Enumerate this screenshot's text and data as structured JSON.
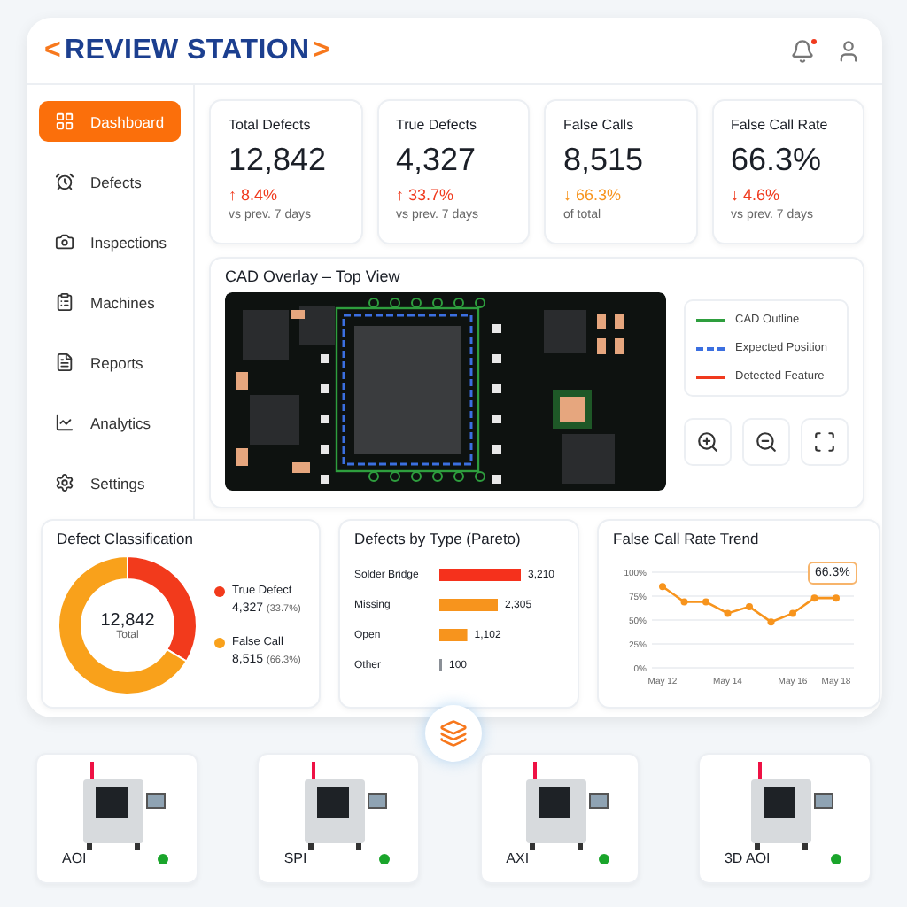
{
  "header": {
    "logo": {
      "left": "<",
      "text": "REVIEW STATION",
      "right": ">"
    },
    "notification": true
  },
  "sidebar": {
    "items": [
      {
        "label": "Dashboard",
        "selected": true
      },
      {
        "label": "Defects",
        "selected": false
      },
      {
        "label": "Inspections",
        "selected": false
      },
      {
        "label": "Machines",
        "selected": false
      },
      {
        "label": "Reports",
        "selected": false
      },
      {
        "label": "Analytics",
        "selected": false
      },
      {
        "label": "Settings",
        "selected": false
      }
    ]
  },
  "kpis": [
    {
      "title": "Total Defects",
      "value": "12,842",
      "delta": "↑ 8.4%",
      "color": "#f03a1e",
      "note": "vs prev. 7 days"
    },
    {
      "title": "True Defects",
      "value": "4,327",
      "delta": "↑ 33.7%",
      "color": "#f03a1e",
      "note": "vs prev. 7 days"
    },
    {
      "title": "False Calls",
      "value": "8,515",
      "delta": "↓ 66.3%",
      "color": "#f7941d",
      "note": "of total"
    },
    {
      "title": "False Call Rate",
      "value": "66.3%",
      "delta": "↓ 4.6%",
      "color": "#f03a1e",
      "note": "vs prev. 7 days"
    }
  ],
  "cad": {
    "title": "CAD Overlay – Top View",
    "legend": [
      {
        "label": "CAD Outline",
        "kind": "solid",
        "color": "#2e9e3e"
      },
      {
        "label": "Expected Position",
        "kind": "dashed",
        "color": "#3b6fe0"
      },
      {
        "label": "Detected Feature",
        "kind": "solid",
        "color": "#f03a1e"
      }
    ]
  },
  "classification": {
    "title": "Defect Classification",
    "center_value": "12,842",
    "center_label": "Total",
    "legend": [
      {
        "value": "4,327",
        "share": "(33.7%)",
        "color": "#f23a1c"
      },
      {
        "value": "8,515",
        "share": "(66.3%)",
        "color": "#f9a11b"
      }
    ],
    "chart_data": {
      "type": "donut",
      "categories": [
        "True Defect",
        "False Call"
      ],
      "values": [
        33.7,
        66.3
      ]
    }
  },
  "pareto": {
    "title": "Defects by Type (Pareto)",
    "bars": [
      {
        "color": "#f5311c"
      },
      {
        "color": "#f7941d"
      },
      {
        "color": "#f7941d"
      },
      {
        "color": "#8a8f96"
      }
    ],
    "chart_data": {
      "type": "bar",
      "orientation": "horizontal",
      "categories": [
        "Solder Bridge",
        "Missing",
        "Open",
        "Other"
      ],
      "values": [
        3210,
        2305,
        1102,
        100
      ],
      "value_labels": [
        "3,210",
        "2,305",
        "1,102",
        "100"
      ]
    }
  },
  "trend": {
    "title": "False Call Rate Trend",
    "chart_data": {
      "type": "line",
      "categories": [
        "May 12",
        null,
        null,
        "May 14",
        null,
        null,
        "May 16",
        null,
        "May 18"
      ],
      "series": [
        {
          "color": "#f7941d",
          "marker": true,
          "values": [
            85,
            69,
            69,
            57,
            64,
            48,
            57,
            73,
            73
          ]
        }
      ],
      "ylim": [
        0,
        100
      ],
      "grid": true,
      "yticks": [
        {
          "value": 0,
          "label": "0%"
        },
        {
          "value": 25,
          "label": "25%"
        },
        {
          "value": 50,
          "label": "50%"
        },
        {
          "value": 75,
          "label": "75%"
        },
        {
          "value": 100,
          "label": "100%"
        }
      ],
      "annotations": [
        {
          "text": "66.3%",
          "x": "May 18",
          "y": 73
        }
      ]
    }
  },
  "machines": [
    {
      "name": "AOI",
      "color": "#1aa52b"
    },
    {
      "name": "SPI",
      "color": "#1aa52b"
    },
    {
      "name": "AXI",
      "color": "#1aa52b"
    },
    {
      "name": "3D AOI",
      "color": "#1aa52b"
    }
  ]
}
